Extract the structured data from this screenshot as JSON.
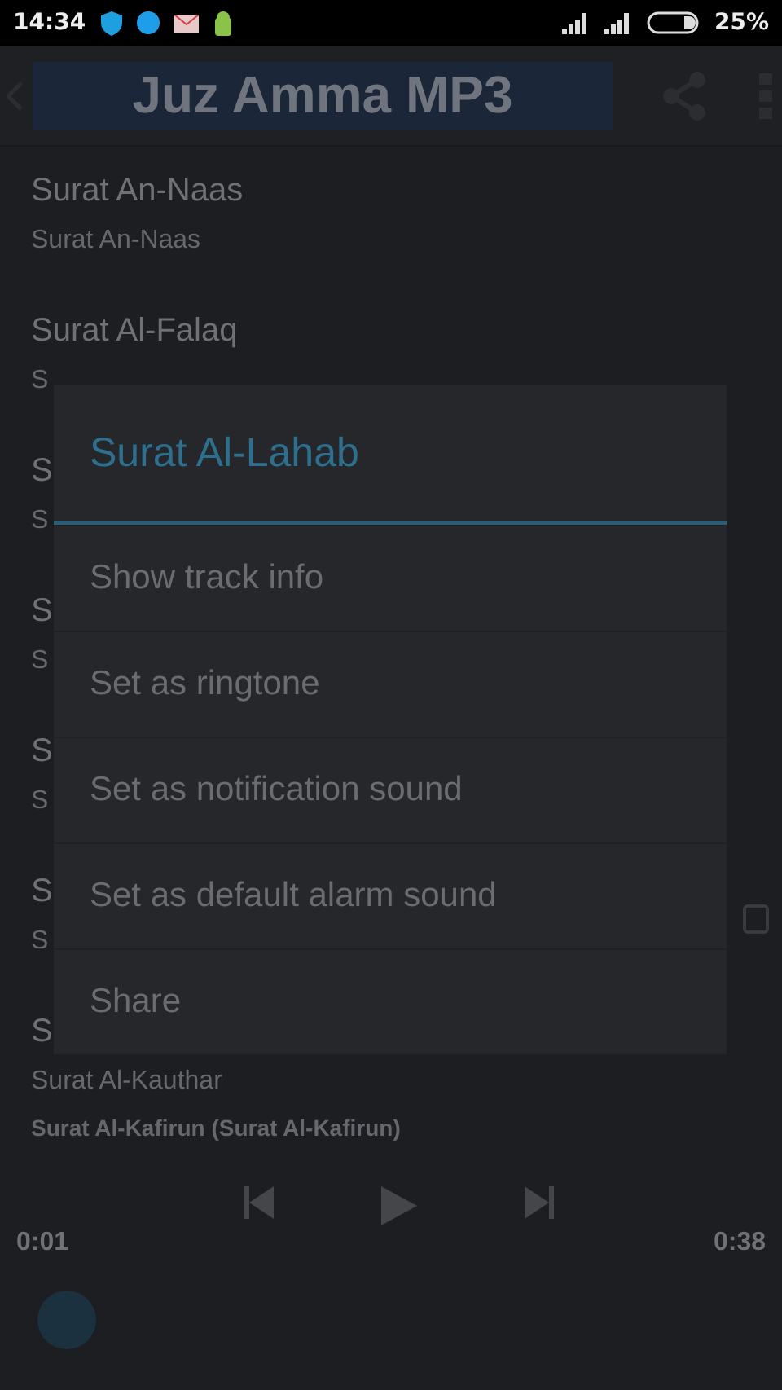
{
  "status_bar": {
    "time": "14:34",
    "battery": "25%"
  },
  "toolbar": {
    "title": "Juz Amma MP3"
  },
  "tracks": [
    {
      "title": "Surat An-Naas",
      "subtitle": "Surat An-Naas"
    },
    {
      "title": "Surat Al-Falaq",
      "subtitle": "S"
    },
    {
      "title": "S",
      "subtitle": "S"
    },
    {
      "title": "S",
      "subtitle": "S"
    },
    {
      "title": "S",
      "subtitle": "S"
    },
    {
      "title": "S",
      "subtitle": "S"
    },
    {
      "title": "S",
      "subtitle": "Surat Al-Kauthar"
    }
  ],
  "player": {
    "now_playing": "Surat Al-Kafirun (Surat Al-Kafirun)",
    "elapsed": "0:01",
    "duration": "0:38"
  },
  "dialog": {
    "title": "Surat Al-Lahab",
    "options": [
      "Show track info",
      "Set as ringtone",
      "Set as notification sound",
      "Set as default alarm sound",
      "Share"
    ]
  }
}
